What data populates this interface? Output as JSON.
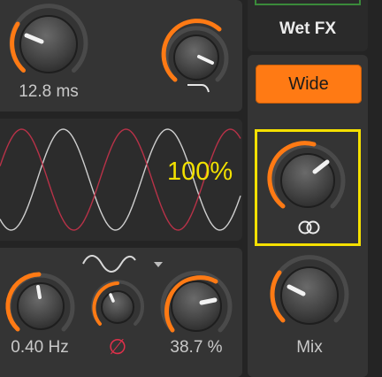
{
  "top_left": {
    "time_value": "12.8 ms"
  },
  "right_column": {
    "wet_fx_label": "Wet FX",
    "wide_button_label": "Wide",
    "mix_label": "Mix"
  },
  "scope": {
    "percent": "100%"
  },
  "lfo": {
    "rate_value": "0.40 Hz",
    "phase_symbol": "∅",
    "depth_value": "38.7 %"
  },
  "colors": {
    "accent": "#ff7a14",
    "highlight": "#f5e000",
    "phase": "#e0304a"
  }
}
